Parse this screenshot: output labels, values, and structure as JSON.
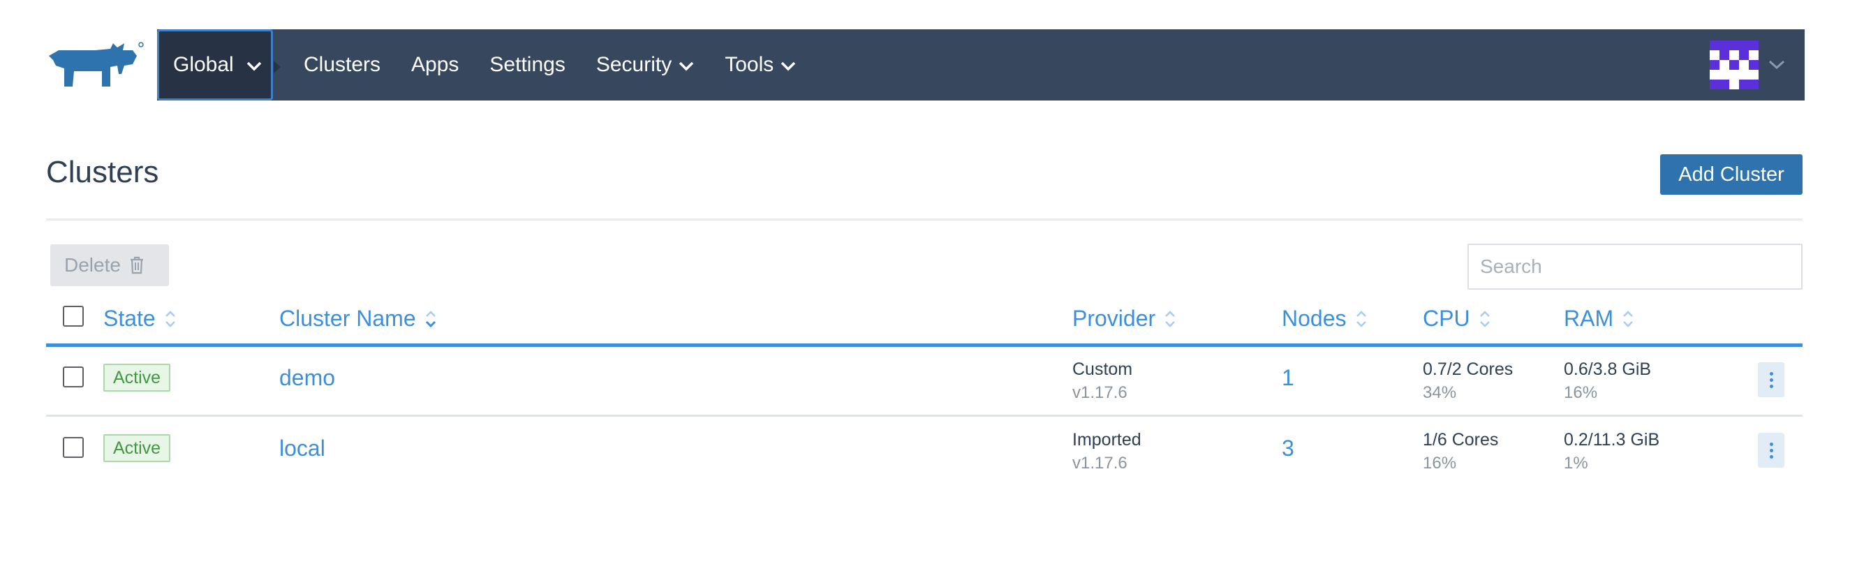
{
  "brand": {
    "logo_icon": "rancher-bull-icon",
    "color": "#2f73ae"
  },
  "nav": {
    "scope_label": "Global",
    "items": [
      {
        "label": "Clusters",
        "has_dropdown": false
      },
      {
        "label": "Apps",
        "has_dropdown": false
      },
      {
        "label": "Settings",
        "has_dropdown": false
      },
      {
        "label": "Security",
        "has_dropdown": true
      },
      {
        "label": "Tools",
        "has_dropdown": true
      }
    ],
    "background": "#37475e",
    "avatar_color": "#5b2fd9"
  },
  "page": {
    "title": "Clusters",
    "add_button": "Add Cluster"
  },
  "toolbar": {
    "delete_label": "Delete",
    "search_placeholder": "Search"
  },
  "table": {
    "columns": {
      "state": "State",
      "name": "Cluster Name",
      "provider": "Provider",
      "nodes": "Nodes",
      "cpu": "CPU",
      "ram": "RAM"
    },
    "rows": [
      {
        "state": "Active",
        "name": "demo",
        "provider": "Custom",
        "version": "v1.17.6",
        "nodes": "1",
        "cpu": "0.7/2 Cores",
        "cpu_pct": "34%",
        "ram": "0.6/3.8 GiB",
        "ram_pct": "16%"
      },
      {
        "state": "Active",
        "name": "local",
        "provider": "Imported",
        "version": "v1.17.6",
        "nodes": "3",
        "cpu": "1/6 Cores",
        "cpu_pct": "16%",
        "ram": "0.2/11.3 GiB",
        "ram_pct": "1%"
      }
    ],
    "accent_color": "#3d8fd9",
    "status_color": "#3f9a3f"
  }
}
